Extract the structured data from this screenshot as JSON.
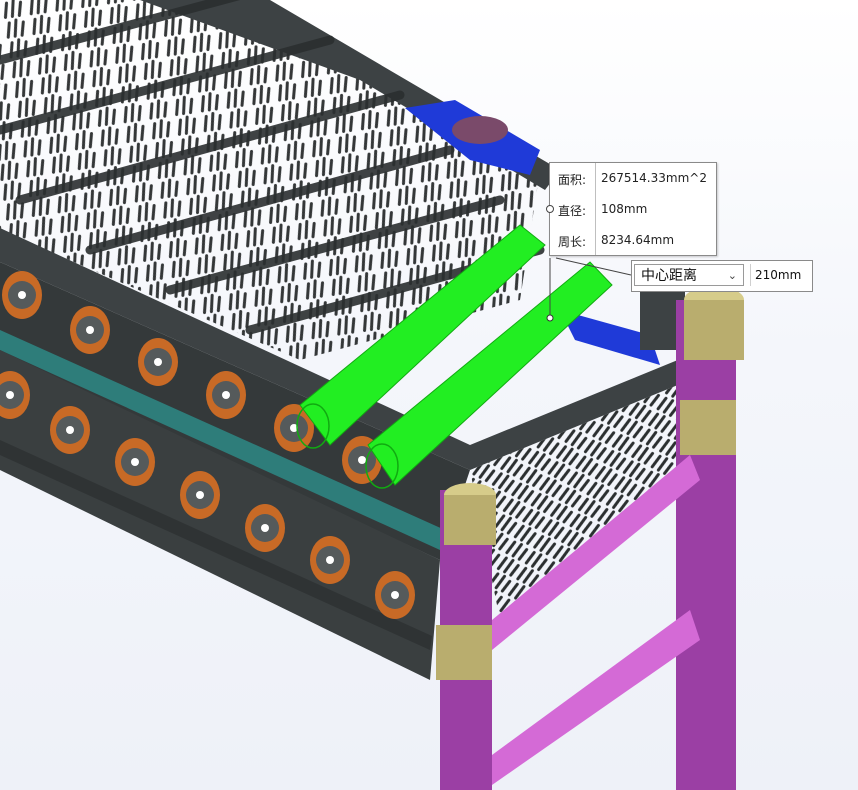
{
  "measure": {
    "area_label": "面积:",
    "area_value": "267514.33mm^2",
    "diameter_label": "直径:",
    "diameter_value": "108mm",
    "perimeter_label": "周长:",
    "perimeter_value": "8234.64mm"
  },
  "distance": {
    "mode_label": "中心距离",
    "value": "210mm"
  },
  "colors": {
    "frame": "#3d4244",
    "highlight": "#22ee22",
    "post_frame": "#9b3fa4",
    "brace": "#d46ad6",
    "collar": "#b9ad6e",
    "wheel": "#c86a26",
    "blue_part": "#1f3ad8",
    "teal_rail": "#2e7d7a"
  },
  "icons": {
    "dropdown": "chevron-down-icon",
    "pin": "pushpin-icon"
  }
}
